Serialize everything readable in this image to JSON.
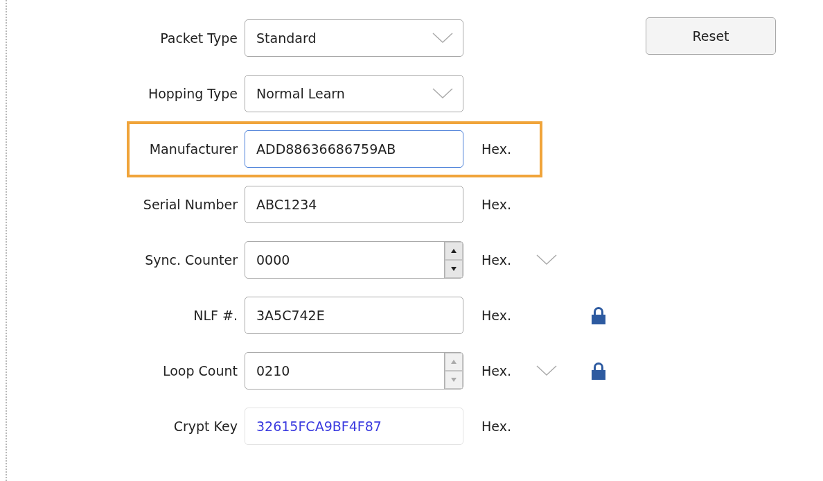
{
  "fields": [
    {
      "label": "Packet Type",
      "kind": "dropdown",
      "value": "Standard",
      "focused": false,
      "highlighted": false
    },
    {
      "label": "Hopping Type",
      "kind": "dropdown",
      "value": "Normal Learn",
      "focused": false,
      "highlighted": false
    },
    {
      "label": "Manufacturer",
      "kind": "text",
      "value": "ADD88636686759AB",
      "unit": "Hex.",
      "focused": true,
      "highlighted": true
    },
    {
      "label": "Serial Number",
      "kind": "text",
      "value": "ABC1234",
      "unit": "Hex.",
      "focused": false,
      "highlighted": false
    },
    {
      "label": "Sync. Counter",
      "kind": "spinner",
      "value": "0000",
      "unit": "Hex.",
      "unit_dropdown": true,
      "spinner_disabled": false,
      "focused": false,
      "highlighted": false
    },
    {
      "label": "NLF #.",
      "kind": "text",
      "value": "3A5C742E",
      "unit": "Hex.",
      "locked": true,
      "focused": false,
      "highlighted": false
    },
    {
      "label": "Loop Count",
      "kind": "spinner",
      "value": "0210",
      "unit": "Hex.",
      "unit_dropdown": true,
      "spinner_disabled": true,
      "locked": true,
      "focused": false,
      "highlighted": false
    },
    {
      "label": "Crypt Key",
      "kind": "readonly",
      "value": "32615FCA9BF4F87",
      "unit": "Hex.",
      "focused": false,
      "highlighted": false
    }
  ],
  "reset_button": "Reset"
}
